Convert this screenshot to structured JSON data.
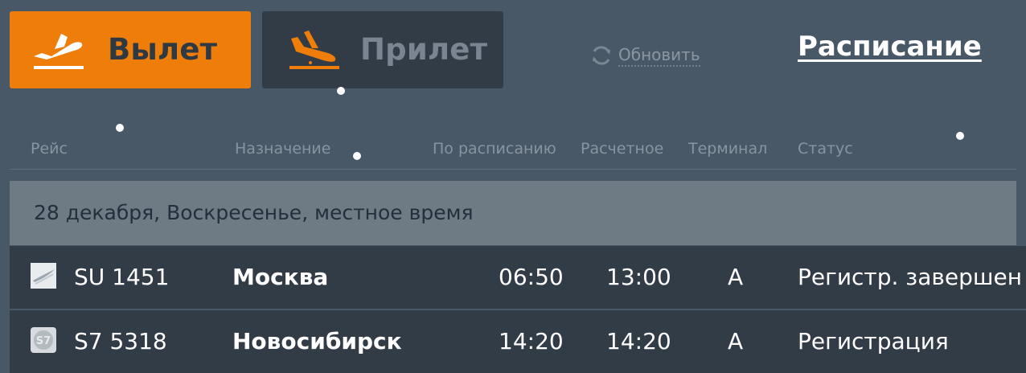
{
  "tabs": {
    "departure": {
      "label": "Вылет",
      "icon": "plane-takeoff-icon"
    },
    "arrival": {
      "label": "Прилет",
      "icon": "plane-landing-icon"
    }
  },
  "refresh": {
    "label": "Обновить",
    "icon": "refresh-icon"
  },
  "schedule_link": "Расписание",
  "columns": [
    "Рейс",
    "Назначение",
    "По расписанию",
    "Расчетное",
    "Терминал",
    "Статус"
  ],
  "date_header": "28 декабря, Воскресенье, местное время",
  "flights": [
    {
      "airline_logo": "aeroflot-logo",
      "flight": "SU 1451",
      "destination": "Москва",
      "scheduled": "06:50",
      "estimated": "13:00",
      "terminal": "A",
      "status": "Регистр. завершен"
    },
    {
      "airline_logo": "s7-logo",
      "flight": "S7 5318",
      "destination": "Новосибирск",
      "scheduled": "14:20",
      "estimated": "14:20",
      "terminal": "A",
      "status": "Регистрация"
    }
  ],
  "colors": {
    "background": "#495866",
    "departure_tab": "#ee7d0a",
    "arrival_tab": "#323c47",
    "date_band": "#6e7a84",
    "row": "#323c47"
  }
}
